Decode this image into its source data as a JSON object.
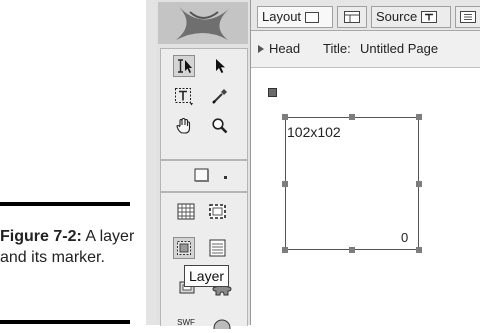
{
  "caption": {
    "label": "Figure 7-2:",
    "text": "A layer and its marker."
  },
  "toolbar": {
    "tooltip": "Layer",
    "swf_label": "SWF"
  },
  "tabs": {
    "layout": "Layout",
    "source": "Source"
  },
  "head": {
    "label": "Head",
    "title_label": "Title:",
    "title_value": "Untitled Page"
  },
  "layer": {
    "size": "102x102",
    "z_index": "0"
  }
}
